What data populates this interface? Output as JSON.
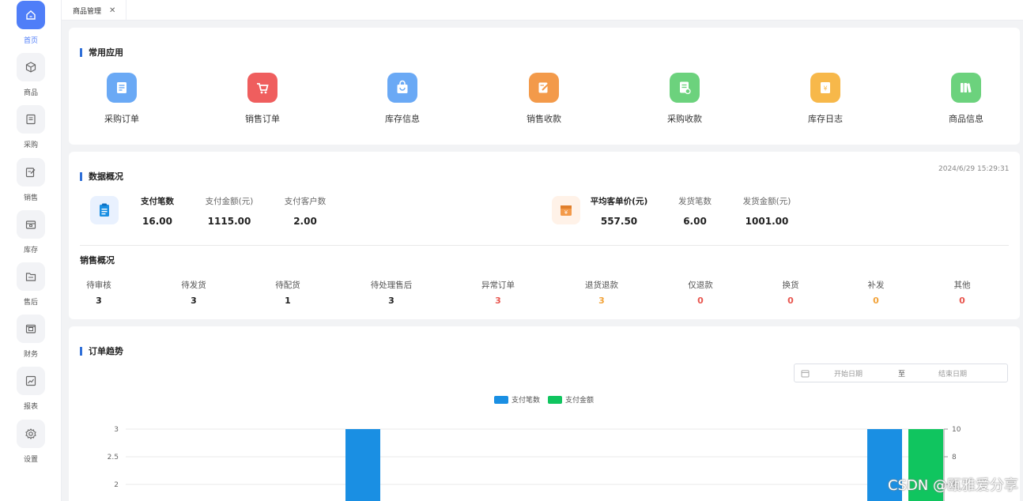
{
  "sidebar": {
    "items": [
      {
        "label": "首页",
        "icon": "home-icon",
        "active": true
      },
      {
        "label": "商品",
        "icon": "cube-icon"
      },
      {
        "label": "采购",
        "icon": "document-icon"
      },
      {
        "label": "销售",
        "icon": "edit-icon"
      },
      {
        "label": "库存",
        "icon": "box-icon"
      },
      {
        "label": "售后",
        "icon": "folder-icon"
      },
      {
        "label": "财务",
        "icon": "safe-icon"
      },
      {
        "label": "报表",
        "icon": "report-icon"
      },
      {
        "label": "设置",
        "icon": "gear-icon"
      }
    ]
  },
  "tabs": [
    {
      "label": "商品管理",
      "close": "✕"
    }
  ],
  "common_apps": {
    "title": "常用应用",
    "items": [
      {
        "label": "采购订单",
        "color": "#6aa9f5",
        "icon": "purchase-order-icon"
      },
      {
        "label": "销售订单",
        "color": "#ef5e5e",
        "icon": "cart-icon"
      },
      {
        "label": "库存信息",
        "color": "#6aa9f5",
        "icon": "bag-icon"
      },
      {
        "label": "销售收款",
        "color": "#f39a4a",
        "icon": "pen-icon"
      },
      {
        "label": "采购收款",
        "color": "#6cd27d",
        "icon": "receipt-icon"
      },
      {
        "label": "库存日志",
        "color": "#f7b84a",
        "icon": "yen-log-icon"
      },
      {
        "label": "商品信息",
        "color": "#6cd27d",
        "icon": "books-icon"
      }
    ]
  },
  "overview": {
    "title": "数据概况",
    "timestamp": "2024/6/29 15:29:31",
    "left": [
      {
        "label": "支付笔数",
        "value": "16.00"
      },
      {
        "label": "支付金额(元)",
        "value": "1115.00"
      },
      {
        "label": "支付客户数",
        "value": "2.00"
      }
    ],
    "right": [
      {
        "label": "平均客单价(元)",
        "value": "557.50"
      },
      {
        "label": "发货笔数",
        "value": "6.00"
      },
      {
        "label": "发货金额(元)",
        "value": "1001.00"
      }
    ]
  },
  "sales": {
    "title": "销售概况",
    "items": [
      {
        "label": "待审核",
        "value": "3",
        "color": "#222222"
      },
      {
        "label": "待发货",
        "value": "3",
        "color": "#222222"
      },
      {
        "label": "待配货",
        "value": "1",
        "color": "#222222"
      },
      {
        "label": "待处理售后",
        "value": "3",
        "color": "#222222"
      },
      {
        "label": "异常订单",
        "value": "3",
        "color": "#e8564f"
      },
      {
        "label": "退货退款",
        "value": "3",
        "color": "#f2a33a"
      },
      {
        "label": "仅退款",
        "value": "0",
        "color": "#e8564f"
      },
      {
        "label": "换货",
        "value": "0",
        "color": "#e8564f"
      },
      {
        "label": "补发",
        "value": "0",
        "color": "#f2a33a"
      },
      {
        "label": "其他",
        "value": "0",
        "color": "#e8564f"
      }
    ]
  },
  "trend": {
    "title": "订单趋势",
    "start_placeholder": "开始日期",
    "separator": "至",
    "end_placeholder": "结束日期"
  },
  "chart_data": {
    "type": "bar",
    "series": [
      {
        "name": "支付笔数",
        "color": "#1a8fe3",
        "axis": "left",
        "bars": [
          {
            "position": "middle-left",
            "value": 3
          },
          {
            "position": "right",
            "value": 3
          }
        ]
      },
      {
        "name": "支付金额",
        "color": "#10c55f",
        "axis": "right",
        "bars": [
          {
            "position": "right",
            "value": 10
          }
        ]
      }
    ],
    "y_left": {
      "ticks": [
        3,
        2.5,
        2
      ]
    },
    "y_right": {
      "ticks": [
        10,
        8,
        6
      ]
    },
    "grid": true,
    "legend": "top-center"
  },
  "watermark": "CSDN @瓯雅爱分享"
}
